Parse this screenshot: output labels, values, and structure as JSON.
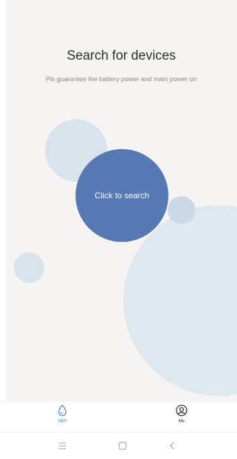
{
  "header": {
    "title": "Search for devices",
    "subtitle": "Pls guarantee the battery power and main power on"
  },
  "main": {
    "search_button_label": "Click to search"
  },
  "tabbar": {
    "tabs": [
      {
        "label": "BBR",
        "icon": "water-drop-icon",
        "active": true
      },
      {
        "label": "Me",
        "icon": "user-profile-icon",
        "active": false
      }
    ]
  },
  "navbar": {
    "buttons": [
      "menu-icon",
      "home-square-icon",
      "back-chevron-icon"
    ]
  },
  "colors": {
    "accent": "#5679b6",
    "active_tab": "#5a8fdc",
    "background": "#f6f4f3",
    "bubble": "#d9e3ec"
  }
}
